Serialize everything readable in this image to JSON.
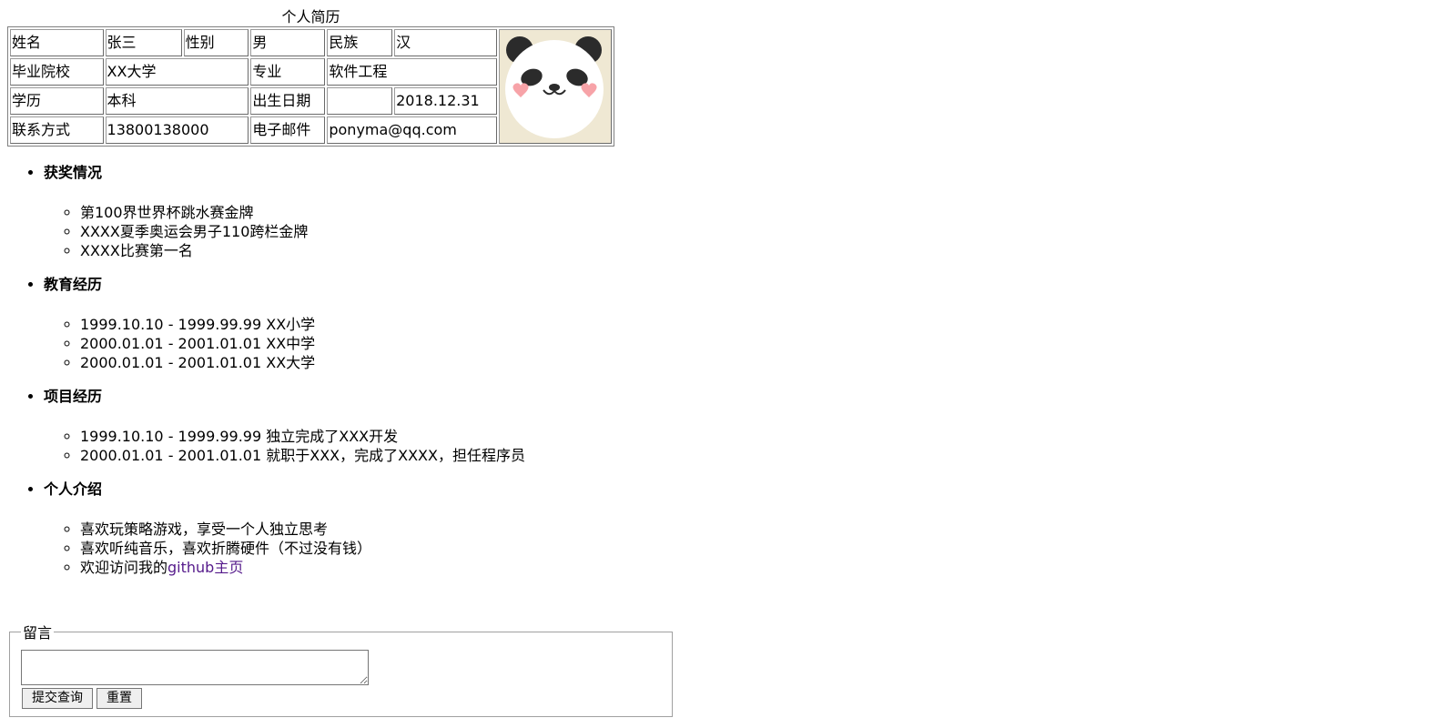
{
  "resume": {
    "title": "个人简历",
    "rows": [
      [
        "姓名",
        "张三",
        "性别",
        "男",
        "民族",
        "汉"
      ],
      [
        "毕业院校",
        "XX大学",
        "专业",
        "软件工程"
      ],
      [
        "学历",
        "本科",
        "出生日期",
        "",
        "2018.12.31"
      ],
      [
        "联系方式",
        "13800138000",
        "电子邮件",
        "ponyma@qq.com"
      ]
    ],
    "photo_icon": "panda-avatar"
  },
  "sections": [
    {
      "title": "获奖情况",
      "items": [
        "第100界世界杯跳水赛金牌",
        "XXXX夏季奥运会男子110跨栏金牌",
        "XXXX比赛第一名"
      ]
    },
    {
      "title": "教育经历",
      "items": [
        "1999.10.10 - 1999.99.99 XX小学",
        "2000.01.01 - 2001.01.01 XX中学",
        "2000.01.01 - 2001.01.01 XX大学"
      ]
    },
    {
      "title": "项目经历",
      "items": [
        "1999.10.10 - 1999.99.99 独立完成了XXX开发",
        "2000.01.01 - 2001.01.01 就职于XXX，完成了XXXX，担任程序员"
      ]
    },
    {
      "title": "个人介绍",
      "items": [
        "喜欢玩策略游戏，享受一个人独立思考",
        "喜欢听纯音乐，喜欢折腾硬件（不过没有钱）"
      ],
      "last_item_prefix": "欢迎访问我的",
      "last_item_link": "github主页"
    }
  ],
  "message": {
    "legend": "留言",
    "textarea_value": "",
    "submit_label": "提交查询",
    "reset_label": "重置"
  },
  "colors": {
    "link": "#551a8b",
    "photo_bg": "#efe8d3"
  }
}
